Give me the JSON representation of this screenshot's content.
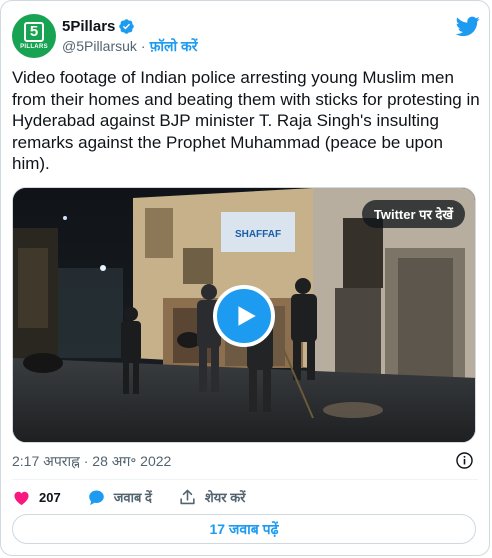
{
  "author": {
    "display_name": "5Pillars",
    "handle": "@5Pillarsuk",
    "separator": "·",
    "follow_label": "फ़ॉलो करें",
    "avatar_mark": "5",
    "avatar_word": "PILLARS",
    "verified": true
  },
  "tweet": {
    "text": "Video footage of Indian police arresting young Muslim men from their homes and beating them with sticks for protesting in Hyderabad against BJP minister T. Raja Singh's insulting remarks against the Prophet Muhammad (peace be upon him)."
  },
  "media": {
    "watch_on_twitter_label": "Twitter पर देखें",
    "sign_text": "SHAFFAF"
  },
  "timestamp": "2:17 अपराह्न · 28 अग॰ 2022",
  "actions": {
    "like_count": "207",
    "reply_label": "जवाब दें",
    "share_label": "शेयर करें"
  },
  "replies_button_label": "17 जवाब पढ़ें",
  "colors": {
    "accent": "#1d9bf0",
    "like": "#f91880",
    "avatar": "#18a352"
  }
}
